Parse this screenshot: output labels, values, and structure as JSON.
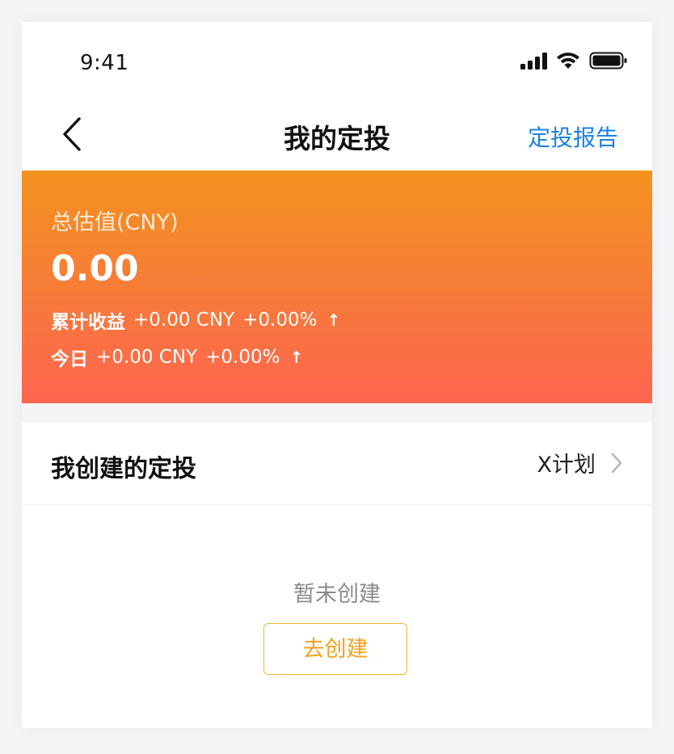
{
  "status_bar": {
    "time": "9:41"
  },
  "nav": {
    "title": "我的定投",
    "report_link": "定投报告"
  },
  "asset_card": {
    "label": "总估值(CNY)",
    "value": "0.00",
    "cumulative": {
      "label": "累计收益",
      "amount": "+0.00 CNY",
      "percent": "+0.00%",
      "arrow": "↑"
    },
    "today": {
      "label": "今日",
      "amount": "+0.00 CNY",
      "percent": "+0.00%",
      "arrow": "↑"
    }
  },
  "plans_section": {
    "title": "我创建的定投",
    "plan_link": "X计划",
    "empty_text": "暂未创建",
    "create_button": "去创建"
  },
  "colors": {
    "accent_blue": "#1a82e3",
    "card_gradient_top": "#f4931f",
    "card_gradient_bottom": "#ff6550",
    "create_button": "#f0a21c"
  }
}
